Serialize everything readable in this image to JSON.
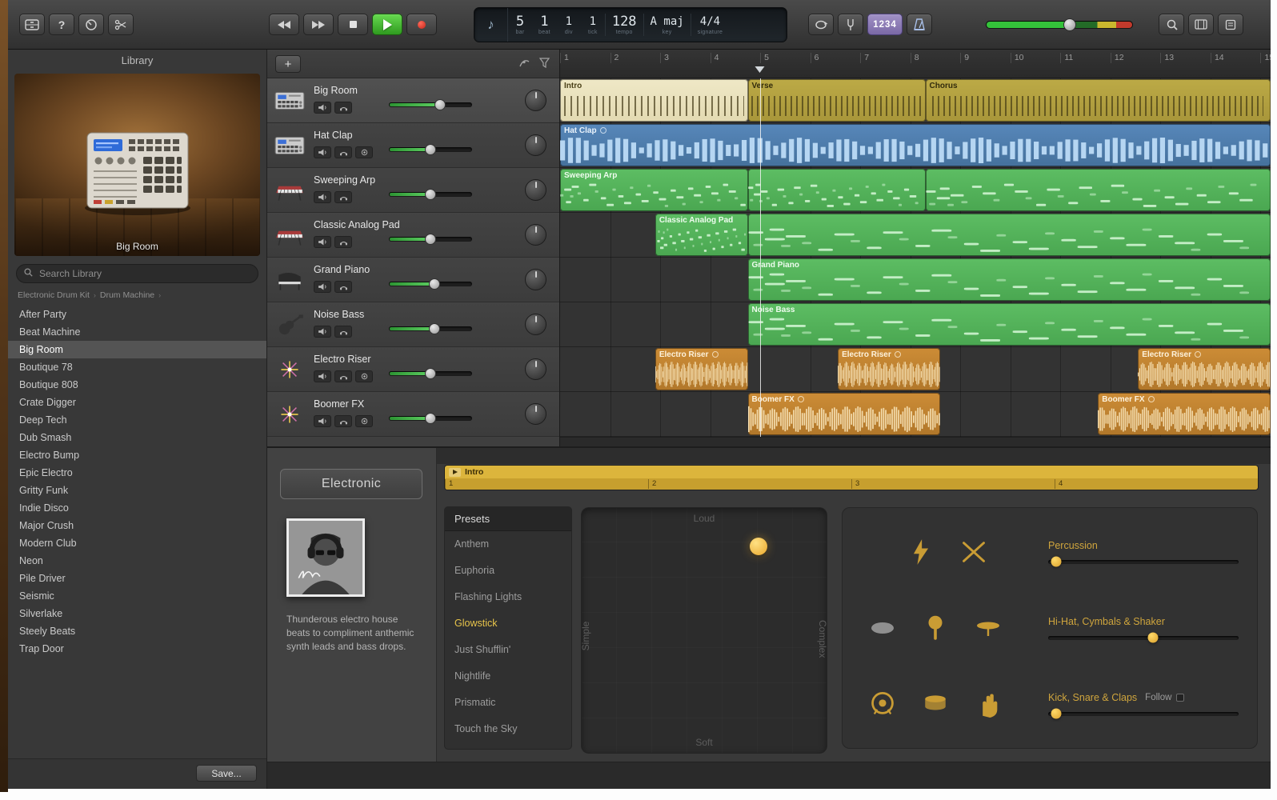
{
  "toolbar": {
    "lcd": {
      "bar": "5",
      "beat": "1",
      "div": "1",
      "tick": "1",
      "bar_label": "bar",
      "beat_label": "beat",
      "div_label": "div",
      "tick_label": "tick",
      "tempo": "128",
      "tempo_label": "tempo",
      "key": "A maj",
      "key_label": "key",
      "signature": "4/4",
      "signature_label": "signature"
    },
    "count_in_label": "1234"
  },
  "library": {
    "title": "Library",
    "patch_name": "Big Room",
    "search_placeholder": "Search Library",
    "breadcrumb": [
      "Electronic Drum Kit",
      "Drum Machine"
    ],
    "items": [
      "After Party",
      "Beat Machine",
      "Big Room",
      "Boutique 78",
      "Boutique 808",
      "Crate Digger",
      "Deep Tech",
      "Dub Smash",
      "Electro Bump",
      "Epic Electro",
      "Gritty Funk",
      "Indie Disco",
      "Major Crush",
      "Modern Club",
      "Neon",
      "Pile Driver",
      "Seismic",
      "Silverlake",
      "Steely Beats",
      "Trap Door"
    ],
    "selected_item": "Big Room",
    "save_button_label": "Save..."
  },
  "arrange": {
    "first_bar": 1,
    "last_bar": 15.2,
    "playhead_bar": 5,
    "add_track_label": "+",
    "tracks": [
      {
        "name": "Big Room",
        "icon": "drum-machine",
        "selected": true,
        "level": 0.62,
        "buttons": [
          "mute",
          "solo"
        ],
        "regions": [
          {
            "label": "Intro",
            "start": 1,
            "end": 4.75,
            "kind": "drummer-light"
          },
          {
            "label": "Verse",
            "start": 4.75,
            "end": 8.3,
            "kind": "drummer"
          },
          {
            "label": "Chorus",
            "start": 8.3,
            "end": 15.2,
            "kind": "drummer"
          }
        ]
      },
      {
        "name": "Hat Clap",
        "icon": "drum-machine",
        "selected": false,
        "level": 0.5,
        "buttons": [
          "mute",
          "solo",
          "input"
        ],
        "regions": [
          {
            "label": "Hat Clap",
            "loop_badge": true,
            "start": 1,
            "end": 15.2,
            "kind": "audio-blue"
          }
        ]
      },
      {
        "name": "Sweeping Arp",
        "icon": "synth",
        "selected": false,
        "level": 0.5,
        "buttons": [
          "mute",
          "solo"
        ],
        "regions": [
          {
            "label": "Sweeping Arp",
            "start": 1,
            "end": 4.75,
            "kind": "midi"
          },
          {
            "label": "",
            "start": 4.75,
            "end": 8.3,
            "kind": "midi"
          },
          {
            "label": "",
            "start": 8.3,
            "end": 15.2,
            "kind": "midi"
          }
        ]
      },
      {
        "name": "Classic Analog Pad",
        "icon": "synth",
        "selected": false,
        "level": 0.5,
        "buttons": [
          "mute",
          "solo"
        ],
        "regions": [
          {
            "label": "Classic Analog Pad",
            "start": 2.9,
            "end": 4.75,
            "kind": "midi"
          },
          {
            "label": "",
            "start": 4.75,
            "end": 15.2,
            "kind": "midi"
          }
        ]
      },
      {
        "name": "Grand Piano",
        "icon": "piano",
        "selected": false,
        "level": 0.55,
        "buttons": [
          "mute",
          "solo"
        ],
        "regions": [
          {
            "label": "Grand Piano",
            "start": 4.75,
            "end": 15.2,
            "kind": "midi"
          }
        ]
      },
      {
        "name": "Noise Bass",
        "icon": "bass",
        "selected": false,
        "level": 0.55,
        "buttons": [
          "mute",
          "solo"
        ],
        "regions": [
          {
            "label": "Noise Bass",
            "start": 4.75,
            "end": 15.2,
            "kind": "midi"
          }
        ]
      },
      {
        "name": "Electro Riser",
        "icon": "fx",
        "selected": false,
        "level": 0.5,
        "buttons": [
          "mute",
          "solo",
          "input"
        ],
        "regions": [
          {
            "label": "Electro Riser",
            "loop_badge": true,
            "start": 2.9,
            "end": 4.75,
            "kind": "audio-orange"
          },
          {
            "label": "Electro Riser",
            "loop_badge": true,
            "start": 6.55,
            "end": 8.6,
            "kind": "audio-orange"
          },
          {
            "label": "Electro Riser",
            "loop_badge": true,
            "start": 12.55,
            "end": 15.2,
            "kind": "audio-orange"
          }
        ]
      },
      {
        "name": "Boomer FX",
        "icon": "fx",
        "selected": false,
        "level": 0.5,
        "buttons": [
          "mute",
          "solo",
          "input"
        ],
        "regions": [
          {
            "label": "Boomer FX",
            "loop_badge": true,
            "start": 4.75,
            "end": 8.6,
            "kind": "audio-orange"
          },
          {
            "label": "Boomer FX",
            "loop_badge": true,
            "start": 11.75,
            "end": 15.2,
            "kind": "audio-orange"
          }
        ]
      }
    ]
  },
  "editor": {
    "genre_label": "Electronic",
    "description": "Thunderous electro house beats to compliment anthemic synth leads and bass drops.",
    "region_name": "Intro",
    "ruler_beats": [
      "1",
      "2",
      "3",
      "4"
    ],
    "presets_title": "Presets",
    "presets": [
      "Anthem",
      "Euphoria",
      "Flashing Lights",
      "Glowstick",
      "Just Shufflin'",
      "Nightlife",
      "Prismatic",
      "Touch the Sky"
    ],
    "selected_preset": "Glowstick",
    "xy_pad": {
      "top": "Loud",
      "bottom": "Soft",
      "left": "Simple",
      "right": "Complex",
      "puck_x": 0.72,
      "puck_y": 0.16
    },
    "control_rows": [
      {
        "icons": [
          "lightning",
          "drumsticks"
        ],
        "label": "Percussion",
        "value": 0.04
      },
      {
        "icons": [
          "shaker",
          "maraca",
          "cymbal"
        ],
        "label": "Hi-Hat, Cymbals & Shaker",
        "value": 0.55
      },
      {
        "icons": [
          "kick-drum",
          "snare-drum",
          "claps"
        ],
        "label": "Kick, Snare & Claps",
        "follow_label": "Follow",
        "value": 0.04
      }
    ]
  },
  "colors": {
    "accent_yellow": "#c9a13b",
    "region_green": "#57b85f",
    "region_blue": "#4a7bb0",
    "region_orange": "#c08030",
    "drummer_yellow": "#b3a038",
    "drummer_cream": "#e9e2be",
    "play_green": "#46b832",
    "record_red": "#d23b2f",
    "count_in_purple": "#8d7cb6"
  }
}
